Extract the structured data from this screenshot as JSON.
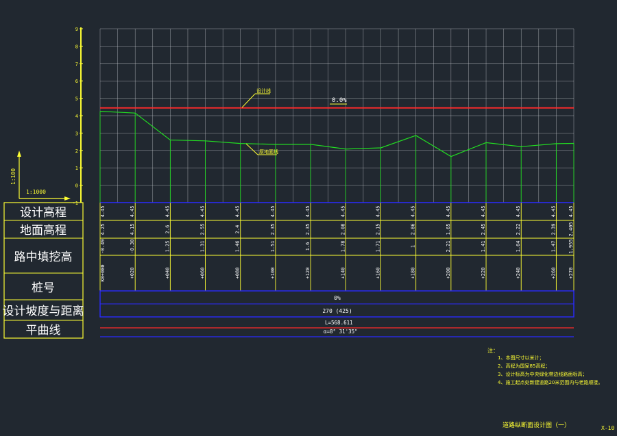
{
  "colors": {
    "background": "#212830",
    "grid": "#c9ccd0",
    "axis": "#ffff33",
    "design_line": "#ff2a2a",
    "ground_line": "#22dd22",
    "table_line": "#ffff33",
    "band_line": "#2a2aff",
    "text": "#ffffff",
    "note_text": "#ffff33"
  },
  "scale": {
    "vertical": "1:100",
    "horizontal": "1:1000"
  },
  "y_axis": {
    "ticks": [
      "9",
      "8",
      "7",
      "6",
      "5",
      "4",
      "3",
      "2",
      "1",
      "0",
      "-1"
    ]
  },
  "profile": {
    "design_line_label": "设计线",
    "ground_line_label": "原地面线",
    "grade_label": "0.0%"
  },
  "row_labels": {
    "design_elev": "设计高程",
    "ground_elev": "地面高程",
    "cut_fill": "路中填挖高",
    "station": "桩号",
    "grade_dist": "设计坡度与距离",
    "plan_curve": "平曲线"
  },
  "stations": [
    {
      "station": "K0+000",
      "design": "4.45",
      "ground": "4.25",
      "cutfill": "-0.49"
    },
    {
      "station": "+020",
      "design": "4.45",
      "ground": "4.15",
      "cutfill": "-0.30"
    },
    {
      "station": "+040",
      "design": "4.45",
      "ground": "2.6",
      "cutfill": "1.25"
    },
    {
      "station": "+060",
      "design": "4.45",
      "ground": "2.55",
      "cutfill": "1.31"
    },
    {
      "station": "+080",
      "design": "4.45",
      "ground": "2.4",
      "cutfill": "1.46"
    },
    {
      "station": "+100",
      "design": "4.45",
      "ground": "2.35",
      "cutfill": "1.51"
    },
    {
      "station": "+120",
      "design": "4.45",
      "ground": "2.35",
      "cutfill": "1.6"
    },
    {
      "station": "+140",
      "design": "4.45",
      "ground": "2.08",
      "cutfill": "1.78"
    },
    {
      "station": "+160",
      "design": "4.45",
      "ground": "2.15",
      "cutfill": "1.71"
    },
    {
      "station": "+180",
      "design": "4.45",
      "ground": "2.86",
      "cutfill": "1"
    },
    {
      "station": "+200",
      "design": "4.45",
      "ground": "1.65",
      "cutfill": "2.21"
    },
    {
      "station": "+220",
      "design": "4.45",
      "ground": "2.45",
      "cutfill": "1.41"
    },
    {
      "station": "+240",
      "design": "4.45",
      "ground": "2.22",
      "cutfill": "1.64"
    },
    {
      "station": "+260",
      "design": "4.45",
      "ground": "2.39",
      "cutfill": "1.47"
    },
    {
      "station": "+270",
      "design": "4.45",
      "ground": "2.405",
      "cutfill": "1.955"
    }
  ],
  "grade_band": {
    "grade": "0%",
    "distance": "270 (425)"
  },
  "curve_band": {
    "length": "L=568.611",
    "angle": "α=8° 31'35\""
  },
  "notes": {
    "heading": "注：",
    "items": [
      "1、本图尺寸以米计；",
      "2、高程为国家85高程；",
      "3、设计标高为中央绿化带边线路面标高；",
      "4、施工起点处新建道路20米范围内与老路顺接。"
    ]
  },
  "title": "道路纵断面设计图（一）",
  "sheet_no": "X-10"
}
